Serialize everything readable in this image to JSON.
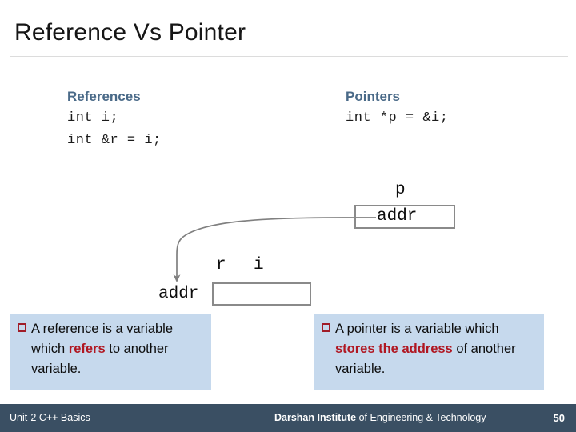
{
  "slide": {
    "title": "Reference Vs Pointer"
  },
  "columns": {
    "references": {
      "heading": "References",
      "code": [
        "int i;",
        "int &r = i;"
      ]
    },
    "pointers": {
      "heading": "Pointers",
      "code": [
        "int *p = &i;"
      ]
    }
  },
  "diagram": {
    "pointer_var": {
      "name": "p",
      "value": "addr"
    },
    "target_var": {
      "ref_name": "r",
      "var_name": "i",
      "address_label": "addr",
      "cell_value": ""
    },
    "arrow": {
      "description": "curved arrow from p box to addr of i",
      "color": "#808080"
    }
  },
  "callouts": {
    "reference": {
      "bullet": "square-bullet-icon",
      "text_before": "A reference is a variable which ",
      "highlight": "refers",
      "text_after": " to another variable."
    },
    "pointer": {
      "bullet": "square-bullet-icon",
      "text_before": "A pointer is a variable which ",
      "highlight": "stores the address",
      "text_after": " of another variable."
    }
  },
  "footer": {
    "left": "Unit-2 C++ Basics",
    "org_bold": "Darshan Institute ",
    "org_rest": "of Engineering & Technology",
    "page": "50"
  },
  "colors": {
    "heading_blue": "#4a6a88",
    "callout_bg": "#c6d9ed",
    "highlight_red": "#b01722",
    "bullet_red": "#a01c28",
    "footer_bg": "#3a4f63",
    "box_border": "#8a8a8a",
    "arrow": "#808080"
  }
}
